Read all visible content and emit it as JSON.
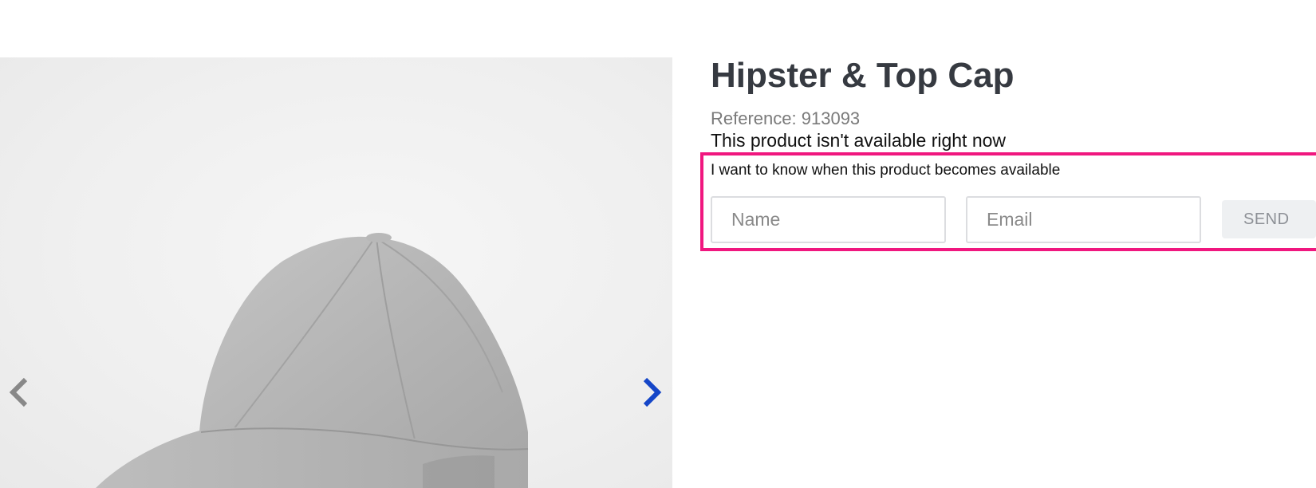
{
  "gallery": {
    "image_alt": "Hipster & Top Cap product photo",
    "prev_icon": "chevron-left-icon",
    "next_icon": "chevron-right-icon"
  },
  "product": {
    "title": "Hipster & Top Cap",
    "reference_label": "Reference:",
    "reference_value": "913093",
    "availability": "This product isn't available right now"
  },
  "notify": {
    "prompt": "I want to know when this product becomes available",
    "name_placeholder": "Name",
    "email_placeholder": "Email",
    "send_label": "SEND"
  },
  "colors": {
    "highlight": "#f0177f",
    "title": "#363a41",
    "next_arrow": "#1546c8",
    "prev_arrow": "#888888"
  }
}
